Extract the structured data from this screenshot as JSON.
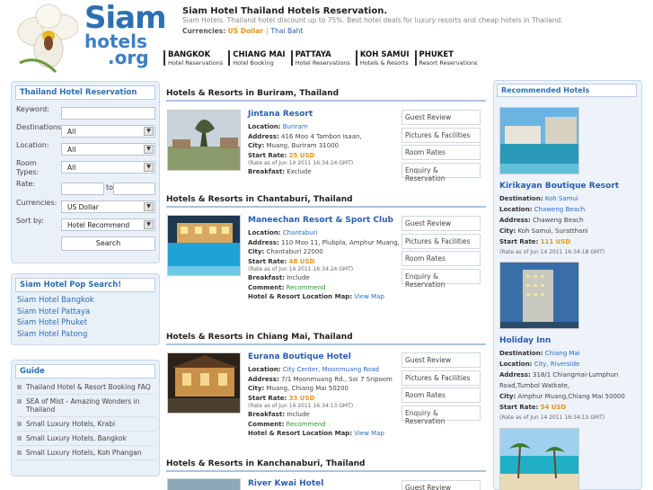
{
  "header": {
    "logo_line1": "Siam",
    "logo_line2": "hotels",
    "logo_line3": ".org",
    "site_title": "Siam Hotel Thailand Hotels Reservation.",
    "site_desc": "Siam Hotels. Thailand hotel discount up to 75%. Best hotel deals for luxury resorts and cheap hotels in Thailand.",
    "currencies_label": "Currencies:",
    "currency_active": "US Dollar",
    "currency_sep": "|",
    "currency_other": "Thai Baht",
    "nav": [
      {
        "title": "BANGKOK",
        "sub": "Hotel Reservations"
      },
      {
        "title": "CHIANG MAI",
        "sub": "Hotel Booking"
      },
      {
        "title": "PATTAYA",
        "sub": "Hotel Reservations"
      },
      {
        "title": "KOH SAMUI",
        "sub": "Hotels & Resorts"
      },
      {
        "title": "PHUKET",
        "sub": "Resort Reservations"
      }
    ]
  },
  "search": {
    "title": "Thailand Hotel Reservation",
    "keyword_label": "Keyword:",
    "destinations_label": "Destinations:",
    "destinations_value": "All",
    "location_label": "Location:",
    "location_value": "All",
    "room_types_label_1": "Room",
    "room_types_label_2": "Types:",
    "room_types_value": "All",
    "rate_label": "Rate:",
    "rate_to": "to",
    "currencies_label": "Currencies:",
    "currencies_value": "US Dollar",
    "sort_label": "Sort by:",
    "sort_value": "Hotel Recommend",
    "search_button": "Search"
  },
  "popular": {
    "title": "Siam Hotel Pop Search!",
    "links": [
      "Siam Hotel Bangkok",
      "Siam Hotel Pattaya",
      "Siam Hotel Phuket",
      "Siam Hotel Patong"
    ]
  },
  "guide": {
    "title": "Guide",
    "items": [
      "Thailand Hotel & Resort Booking FAQ",
      "SEA of Mist - Amazing Wonders in Thailand",
      "Small Luxury Hotels, Krabi",
      "Small Luxury Hotels, Bangkok",
      "Small Luxury Hotels, Koh Phangan"
    ]
  },
  "labels": {
    "location": "Location:",
    "address": "Address:",
    "city": "City:",
    "start_rate": "Start Rate:",
    "breakfast": "Breakfast:",
    "comment": "Comment:",
    "map": "Hotel & Resort Location Map:",
    "view_map": "View Map",
    "destination": "Destination:"
  },
  "actions": {
    "review": "Guest Review",
    "pictures": "Pictures & Facilities",
    "rates": "Room Rates",
    "enquiry": "Enquiry & Reservation"
  },
  "sections": [
    {
      "heading": "Hotels & Resorts in Buriram, Thailand",
      "hotel": {
        "name": "Jintana Resort",
        "location": "Buriram",
        "address": "416 Moo 4 Tambon Isaan,",
        "city": "Muang, Buriram 31000",
        "rate": "25 USD",
        "rate_note": "(Rate as of Jun 14 2011 16:34:24 GMT)",
        "breakfast": "Exclude"
      }
    },
    {
      "heading": "Hotels & Resorts in Chantaburi, Thailand",
      "hotel": {
        "name": "Maneechan Resort & Sport Club",
        "location": "Chantaburi",
        "address": "110 Moo 11, Plubpla, Amphur Muang,",
        "city": "Chantaburi 22000",
        "rate": "48 USD",
        "rate_note": "(Rate as of Jun 14 2011 16:34:24 GMT)",
        "breakfast": "Include",
        "comment": "Recommend"
      }
    },
    {
      "heading": "Hotels & Resorts in Chiang Mai, Thailand",
      "hotel": {
        "name": "Eurana Boutique Hotel",
        "location": "City Center, Moonmuang Road",
        "address": "7/1 Moonmuang Rd., Soi 7 Sripoom",
        "city": "Muang, Chiang Mai 50200",
        "rate": "33 USD",
        "rate_note": "(Rate as of Jun 14 2011 16:34:13 GMT)",
        "breakfast": "Include",
        "comment": "Recommend"
      }
    },
    {
      "heading": "Hotels & Resorts in Kanchanaburi, Thailand",
      "hotel": {
        "name": "River Kwai Hotel"
      }
    }
  ],
  "recommended": {
    "title": "Recommended Hotels",
    "hotels": [
      {
        "name": "Kirikayan Boutique Resort",
        "destination": "Koh Samui",
        "location": "Chaweng Beach",
        "address": "Chaweng Beach",
        "city": "Koh Samui, Suratthani",
        "rate": "111 USD",
        "rate_note": "(Rate as of Jun 14 2011 16:34:18 GMT)"
      },
      {
        "name": "Holiday Inn",
        "destination": "Chiang Mai",
        "location": "City, Riverside",
        "address": "318/1 Chiangmai-Lumphun Road,Tumbol Watkate,",
        "city": "Amphur Muang,Chiang Mai 50000",
        "rate": "54 USD",
        "rate_note": "(Rate as of Jun 14 2011 16:34:13 GMT)"
      }
    ]
  },
  "colors": {
    "brand_blue": "#2d6fb3",
    "link": "#2a5db0",
    "rate_orange": "#e8941a",
    "recommend_green": "#2a9b2a",
    "panel_bg": "#e9f0f8"
  }
}
